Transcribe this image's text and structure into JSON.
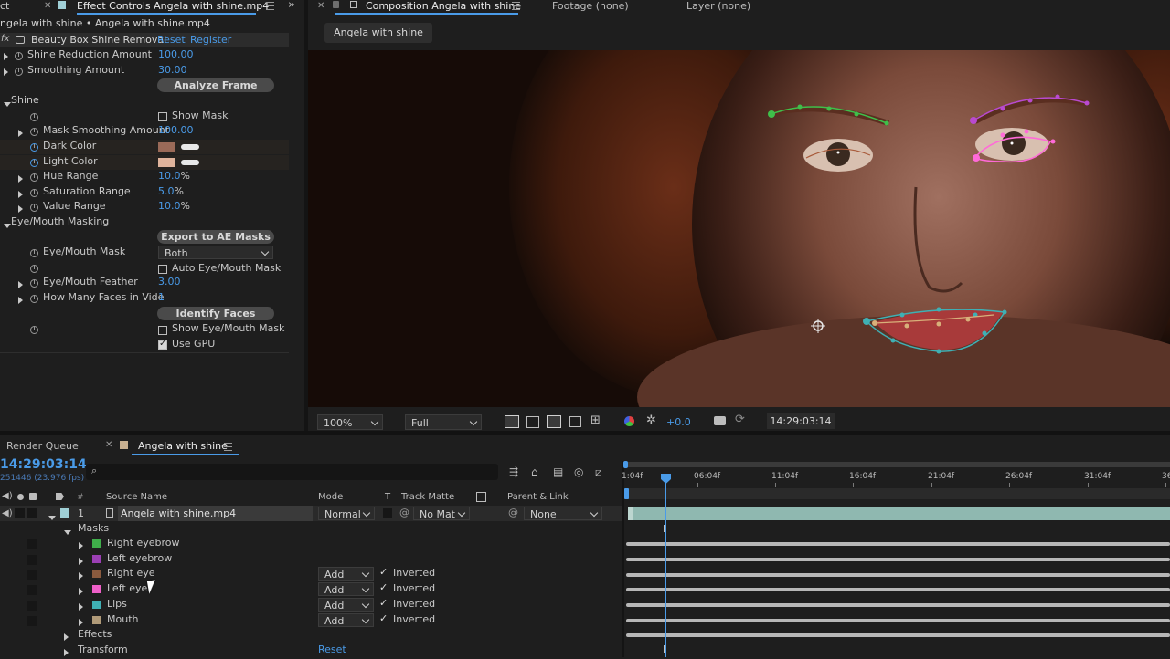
{
  "effect_controls": {
    "tab_left_fragment": "ct",
    "tab_title": "Effect Controls Angela with shine.mp4",
    "breadcrumb": "ngela with shine • Angela with shine.mp4",
    "effect_name": "Beauty Box Shine Removal",
    "reset": "Reset",
    "register": "Register",
    "shine_reduction_label": "Shine Reduction Amount",
    "shine_reduction_value": "100.00",
    "smoothing_label": "Smoothing Amount",
    "smoothing_value": "30.00",
    "analyze_btn": "Analyze Frame",
    "shine_group": "Shine",
    "show_mask": "Show Mask",
    "mask_smoothing_label": "Mask Smoothing Amount",
    "mask_smoothing_value": "100.00",
    "dark_color_label": "Dark Color",
    "dark_color": "#9a6a58",
    "light_color_label": "Light Color",
    "light_color": "#e0b49c",
    "hue_label": "Hue Range",
    "hue_value": "10.0",
    "sat_label": "Saturation Range",
    "sat_value": "5.0",
    "val_label": "Value Range",
    "val_value": "10.0",
    "pct": "%",
    "eye_mouth_group": "Eye/Mouth Masking",
    "export_btn": "Export to AE Masks",
    "eye_mouth_mask_label": "Eye/Mouth Mask",
    "eye_mouth_mask_value": "Both",
    "auto_mask": "Auto Eye/Mouth Mask",
    "feather_label": "Eye/Mouth Feather",
    "feather_value": "3.00",
    "faces_label": "How Many Faces in Vide",
    "faces_value": "1",
    "identify_btn": "Identify Faces",
    "show_eye_mouth_mask": "Show Eye/Mouth Mask",
    "use_gpu": "Use GPU"
  },
  "composition": {
    "tab_title": "Composition Angela with shine",
    "footage_tab": "Footage (none)",
    "layer_tab": "Layer (none)",
    "comp_button": "Angela with shine",
    "zoom": "100%",
    "resolution": "Full",
    "exposure": "+0.0",
    "timecode": "14:29:03:14"
  },
  "timeline": {
    "render_queue_tab": "Render Queue",
    "comp_tab": "Angela with shine",
    "timecode": "14:29:03:14",
    "frame_info": "251446 (23.976 fps)",
    "search_placeholder": "",
    "col_source": "Source Name",
    "col_mode": "Mode",
    "col_t": "T",
    "col_matte": "Track Matte",
    "col_parent": "Parent & Link",
    "ruler": [
      "1:04f",
      "06:04f",
      "11:04f",
      "16:04f",
      "21:04f",
      "26:04f",
      "31:04f",
      "36"
    ],
    "layer": {
      "num": "1",
      "name": "Angela with shine.mp4",
      "mode": "Normal",
      "matte": "No Mat",
      "parent": "None"
    },
    "masks_label": "Masks",
    "masks": [
      {
        "name": "Right eyebrow",
        "color": "#3fae4a",
        "mode": "",
        "inverted": ""
      },
      {
        "name": "Left eyebrow",
        "color": "#9b3fb4",
        "mode": "",
        "inverted": ""
      },
      {
        "name": "Right eye",
        "color": "#8a5a3e",
        "mode": "Add",
        "inverted": "Inverted"
      },
      {
        "name": "Left eye",
        "color": "#ee5fc8",
        "mode": "Add",
        "inverted": "Inverted"
      },
      {
        "name": "Lips",
        "color": "#3fb0b4",
        "mode": "Add",
        "inverted": "Inverted"
      },
      {
        "name": "Mouth",
        "color": "#b09a78",
        "mode": "Add",
        "inverted": "Inverted"
      }
    ],
    "effects_label": "Effects",
    "transform_label": "Transform",
    "transform_reset": "Reset"
  }
}
